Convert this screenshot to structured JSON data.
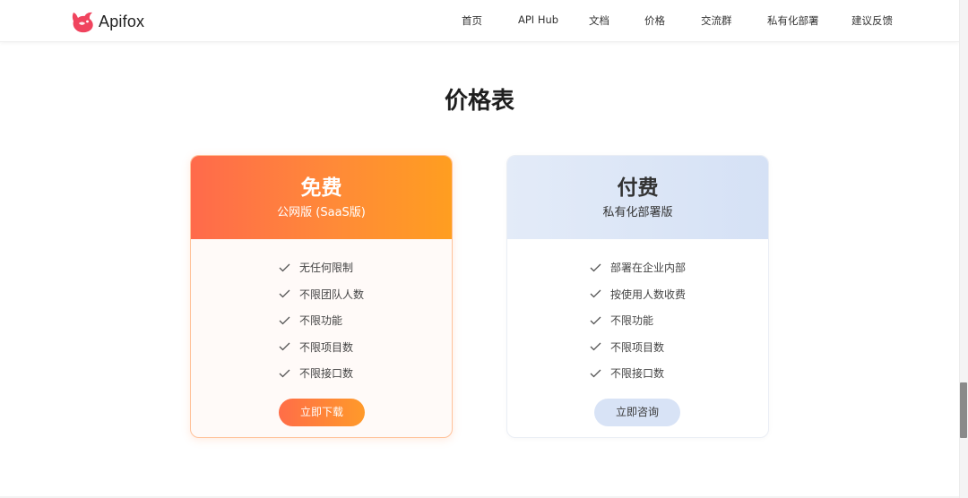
{
  "header": {
    "logo_text": "Apifox",
    "nav": [
      {
        "label": "首页"
      },
      {
        "label": "API Hub"
      },
      {
        "label": "文档"
      },
      {
        "label": "价格"
      },
      {
        "label": "交流群"
      },
      {
        "label": "私有化部署"
      },
      {
        "label": "建议反馈"
      }
    ]
  },
  "main": {
    "title": "价格表",
    "plans": [
      {
        "title": "免费",
        "subtitle": "公网版 (SaaS版)",
        "features": [
          "无任何限制",
          "不限团队人数",
          "不限功能",
          "不限项目数",
          "不限接口数"
        ],
        "button_label": "立即下载"
      },
      {
        "title": "付费",
        "subtitle": "私有化部署版",
        "features": [
          "部署在企业内部",
          "按使用人数收费",
          "不限功能",
          "不限项目数",
          "不限接口数"
        ],
        "button_label": "立即咨询"
      }
    ]
  },
  "colors": {
    "brand": "#f0445e",
    "free_gradient_start": "#ff6a4b",
    "free_gradient_end": "#ff9e20",
    "paid_header_bg": "#dce6f7"
  },
  "icons": {
    "logo": "apifox-logo-icon",
    "feature": "check-icon"
  }
}
